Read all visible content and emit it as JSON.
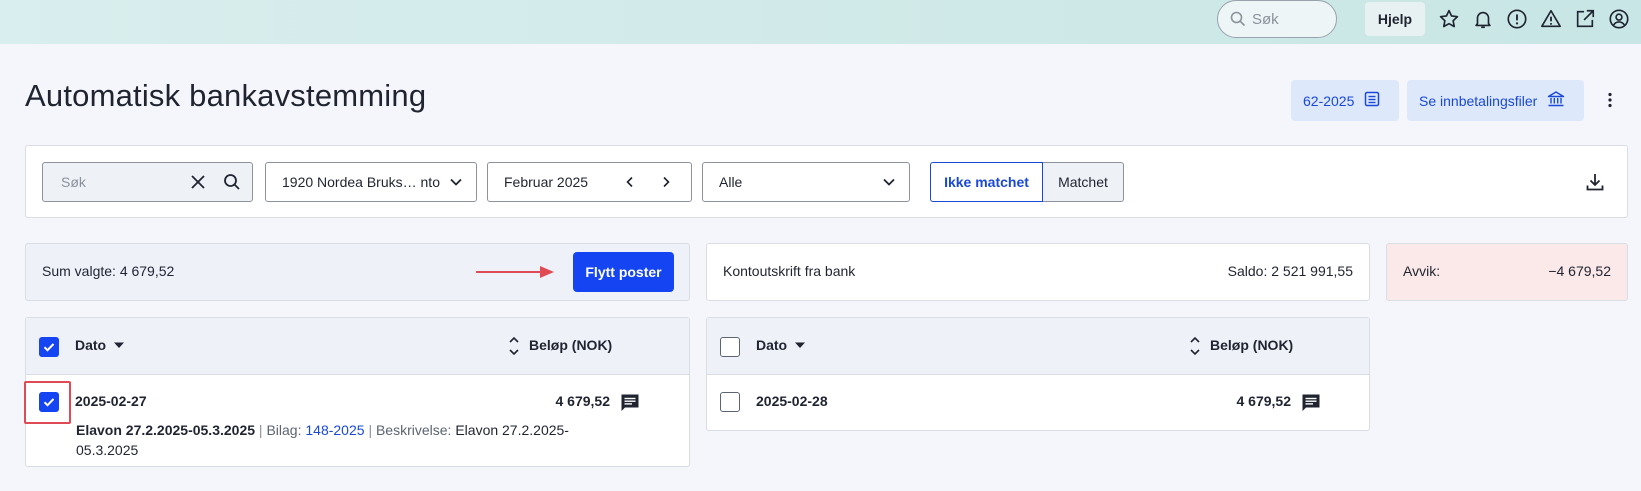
{
  "topbar": {
    "search_placeholder": "Søk",
    "help_label": "Hjelp",
    "icons": [
      "star-icon",
      "bell-icon",
      "alert-circle-icon",
      "warning-icon",
      "external-link-icon",
      "user-icon"
    ]
  },
  "page": {
    "title": "Automatisk bankavstemming",
    "voucher_button": "62-2025",
    "payment_files_button": "Se innbetalingsfiler"
  },
  "filters": {
    "search_placeholder": "Søk",
    "account": "1920 Nordea Bruks… nto",
    "period": "Februar 2025",
    "status_select": "Alle",
    "toggle_unmatched": "Ikke matchet",
    "toggle_matched": "Matchet"
  },
  "summary": {
    "selected_label": "Sum valgte: 4 679,52",
    "move_button": "Flytt poster",
    "bank_statement_label": "Kontoutskrift fra bank",
    "balance_label": "Saldo: 2 521 991,55",
    "deviation_label": "Avvik:",
    "deviation_value": "−4 679,52"
  },
  "ledger_table": {
    "col_date": "Dato",
    "col_amount": "Beløp (NOK)",
    "rows": [
      {
        "date": "2025-02-27",
        "amount": "4 679,52",
        "checked": true,
        "title": "Elavon 27.2.2025-05.3.2025",
        "bilag_label": "Bilag:",
        "bilag_value": "148-2025",
        "desc_label": "Beskrivelse:",
        "desc_value": "Elavon 27.2.2025-05.3.2025"
      }
    ]
  },
  "bank_table": {
    "col_date": "Dato",
    "col_amount": "Beløp (NOK)",
    "rows": [
      {
        "date": "2025-02-28",
        "amount": "4 679,52",
        "checked": false
      }
    ]
  },
  "colors": {
    "primary": "#1544f2",
    "link": "#1a49d6",
    "highlight": "#e04a55",
    "deviation_bg": "#fbe8e8"
  }
}
